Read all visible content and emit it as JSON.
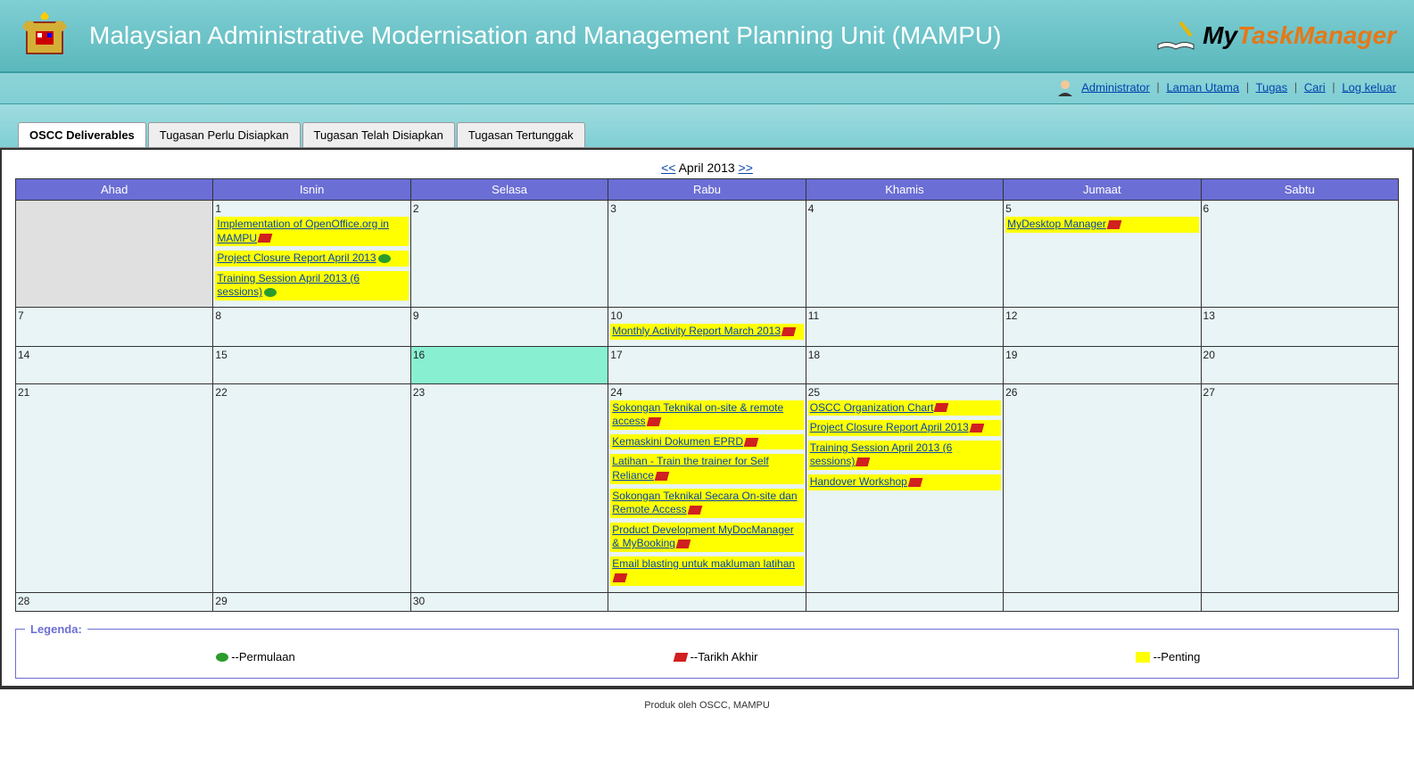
{
  "header": {
    "title": "Malaysian Administrative Modernisation and Management Planning Unit (MAMPU)",
    "logo_my": "My",
    "logo_task": "Task",
    "logo_manager": "Manager"
  },
  "nav": {
    "admin": "Administrator",
    "home": "Laman Utama",
    "tasks": "Tugas",
    "search": "Cari",
    "logout": "Log keluar"
  },
  "tabs": [
    {
      "label": "OSCC Deliverables",
      "active": true
    },
    {
      "label": "Tugasan Perlu Disiapkan",
      "active": false
    },
    {
      "label": "Tugasan Telah Disiapkan",
      "active": false
    },
    {
      "label": "Tugasan Tertunggak",
      "active": false
    }
  ],
  "calendar": {
    "prev": "<<",
    "next": ">>",
    "month_label": "April 2013",
    "days": [
      "Ahad",
      "Isnin",
      "Selasa",
      "Rabu",
      "Khamis",
      "Jumaat",
      "Sabtu"
    ],
    "events": {
      "1": [
        {
          "title": "Implementation of OpenOffice.org in MAMPU",
          "flag": "red"
        },
        {
          "title": "Project Closure Report April 2013",
          "flag": "green"
        },
        {
          "title": "Training Session April 2013 (6 sessions)",
          "flag": "green"
        }
      ],
      "5": [
        {
          "title": "MyDesktop Manager",
          "flag": "red"
        }
      ],
      "10": [
        {
          "title": "Monthly Activity Report March 2013",
          "flag": "red"
        }
      ],
      "24": [
        {
          "title": "Sokongan Teknikal on-site & remote access",
          "flag": "red"
        },
        {
          "title": "Kemaskini Dokumen EPRD",
          "flag": "red"
        },
        {
          "title": "Latihan - Train the trainer for Self Reliance",
          "flag": "red"
        },
        {
          "title": "Sokongan Teknikal Secara On-site dan Remote Access",
          "flag": "red"
        },
        {
          "title": "Product Development MyDocManager & MyBooking",
          "flag": "red"
        },
        {
          "title": "Email blasting untuk makluman latihan",
          "flag": "red"
        }
      ],
      "25": [
        {
          "title": "OSCC Organization Chart",
          "flag": "red"
        },
        {
          "title": "Project Closure Report April 2013",
          "flag": "red"
        },
        {
          "title": "Training Session April 2013 (6 sessions)",
          "flag": "red"
        },
        {
          "title": "Handover Workshop",
          "flag": "red"
        }
      ]
    }
  },
  "legend": {
    "title": "Legenda:",
    "start": "--Permulaan",
    "end": "--Tarikh Akhir",
    "important": "--Penting"
  },
  "footer": "Produk oleh OSCC, MAMPU"
}
